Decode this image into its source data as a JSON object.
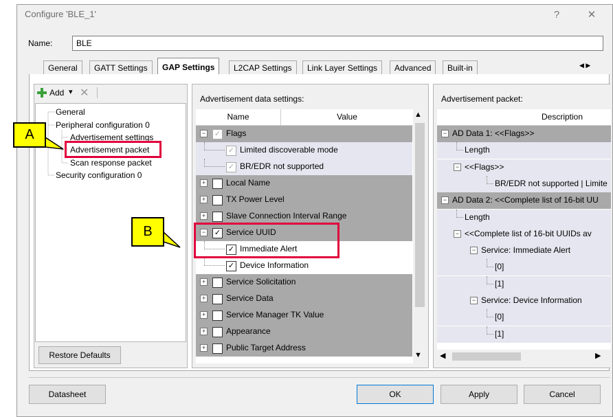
{
  "window": {
    "title": "Configure 'BLE_1'",
    "help_label": "?",
    "close_label": "✕"
  },
  "name": {
    "label": "Name:",
    "value": "BLE"
  },
  "tabs": [
    "General",
    "GATT Settings",
    "GAP Settings",
    "L2CAP Settings",
    "Link Layer Settings",
    "Advanced",
    "Built-in"
  ],
  "tab_scroll": "◀ ▶",
  "left_toolbar": {
    "add_label": "Add",
    "dropdown": "▾",
    "delete_icon": "✕"
  },
  "tree": {
    "general": "General",
    "peripheral": "Peripheral configuration 0",
    "adv_settings": "Advertisement settings",
    "adv_packet": "Advertisement packet",
    "scan_response": "Scan response packet",
    "security": "Security configuration 0"
  },
  "restore_label": "Restore Defaults",
  "middle": {
    "header": "Advertisement data settings:",
    "col_name": "Name",
    "col_value": "Value",
    "rows": [
      {
        "label": "Flags",
        "type": "group",
        "checked": true,
        "expand": "−"
      },
      {
        "label": "Limited discoverable mode",
        "type": "sub",
        "checked": true
      },
      {
        "label": "BR/EDR not supported",
        "type": "sub",
        "checked": true
      },
      {
        "label": "Local Name",
        "type": "group",
        "checked": false,
        "expand": "+"
      },
      {
        "label": "TX Power Level",
        "type": "group",
        "checked": false,
        "expand": "+"
      },
      {
        "label": "Slave Connection Interval Range",
        "type": "group",
        "checked": false,
        "expand": "+"
      },
      {
        "label": "Service UUID",
        "type": "group",
        "checked": true,
        "expand": "−"
      },
      {
        "label": "Immediate Alert",
        "type": "sel",
        "checked": true
      },
      {
        "label": "Device Information",
        "type": "sel",
        "checked": true
      },
      {
        "label": "Service Solicitation",
        "type": "group",
        "checked": false,
        "expand": "+"
      },
      {
        "label": "Service Data",
        "type": "group",
        "checked": false,
        "expand": "+"
      },
      {
        "label": "Service Manager TK Value",
        "type": "group",
        "checked": false,
        "expand": "+"
      },
      {
        "label": "Appearance",
        "type": "group",
        "checked": false,
        "expand": "+"
      },
      {
        "label": "Public Target Address",
        "type": "group",
        "checked": false,
        "expand": "+"
      }
    ]
  },
  "right": {
    "header": "Advertisement packet:",
    "col_desc": "Description",
    "rows": [
      {
        "label": "AD Data 1: <<Flags>>",
        "indent": 0,
        "type": "group",
        "expand": "−"
      },
      {
        "label": "Length",
        "indent": 1,
        "type": "item"
      },
      {
        "label": "<<Flags>>",
        "indent": 1,
        "type": "item",
        "expand": "−"
      },
      {
        "label": "BR/EDR not supported | Limite",
        "indent": 3,
        "type": "item"
      },
      {
        "label": "AD Data 2: <<Complete list of 16-bit UU",
        "indent": 0,
        "type": "group",
        "expand": "−"
      },
      {
        "label": "Length",
        "indent": 1,
        "type": "item"
      },
      {
        "label": "<<Complete list of 16-bit UUIDs av",
        "indent": 1,
        "type": "item",
        "expand": "−"
      },
      {
        "label": "Service: Immediate Alert",
        "indent": 2,
        "type": "item",
        "expand": "−"
      },
      {
        "label": "[0]",
        "indent": 3,
        "type": "item"
      },
      {
        "label": "[1]",
        "indent": 3,
        "type": "item"
      },
      {
        "label": "Service: Device Information",
        "indent": 2,
        "type": "item",
        "expand": "−"
      },
      {
        "label": "[0]",
        "indent": 3,
        "type": "item"
      },
      {
        "label": "[1]",
        "indent": 3,
        "type": "item"
      }
    ]
  },
  "buttons": {
    "datasheet": "Datasheet",
    "ok": "OK",
    "apply": "Apply",
    "cancel": "Cancel"
  },
  "callouts": {
    "a": "A",
    "b": "B"
  },
  "colors": {
    "highlight_red": "#e0003c",
    "callout_yellow": "#ffff00",
    "group_gray": "#a9a9a9",
    "sub_lavender": "#e6e6f0"
  }
}
